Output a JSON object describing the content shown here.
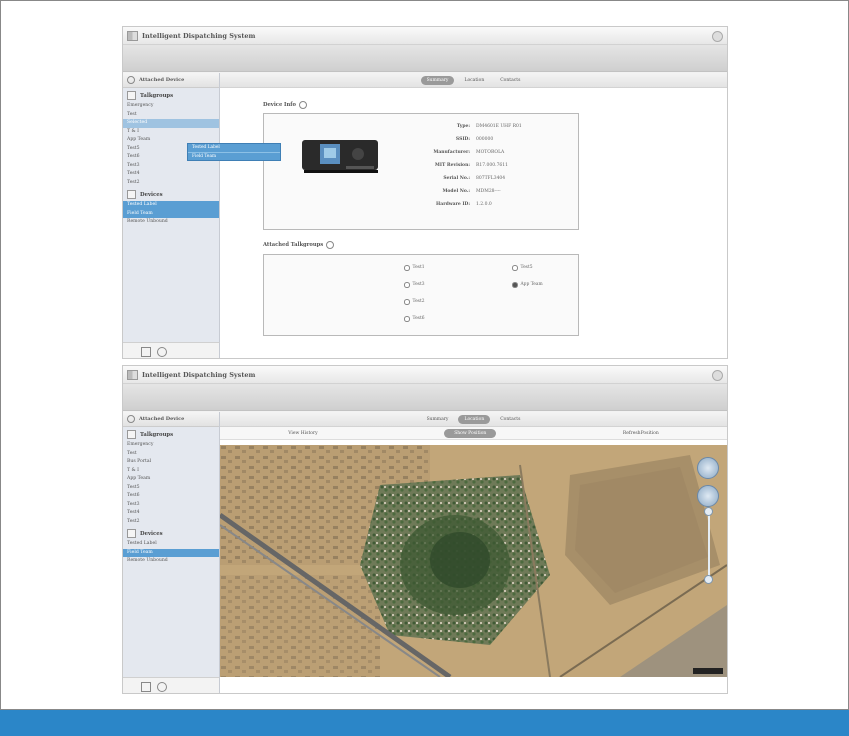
{
  "window_top": {
    "title": "Intelligent Dispatching System",
    "sidebar": {
      "header": "Attached Device",
      "talkgroups_title": "Talkgroups",
      "talkgroups": [
        "Emergency",
        "Test",
        "Selected",
        "T & I",
        "App Team",
        "Test5",
        "Test6",
        "Test3",
        "Test4",
        "Test2"
      ],
      "devices_title": "Devices",
      "devices": [
        "Tested Label",
        "Field Team",
        "Remote Unbound"
      ]
    },
    "tabs": [
      "Summary",
      "Location",
      "Contacts"
    ],
    "active_tab": 0,
    "popup_items": [
      "Tested Label",
      "Field Team"
    ],
    "device_info": {
      "title": "Device Info",
      "fields": [
        {
          "label": "Type:",
          "value": "DM4601E UHF R01"
        },
        {
          "label": "SSID:",
          "value": "000000"
        },
        {
          "label": "Manufacturer:",
          "value": "MOTOROLA"
        },
        {
          "label": "MIT Revision:",
          "value": "R17.000.7611"
        },
        {
          "label": "Serial No.:",
          "value": "807TFL3404"
        },
        {
          "label": "Model No.:",
          "value": "MDM28----"
        },
        {
          "label": "Hardware ID:",
          "value": "1.2.0.0"
        }
      ]
    },
    "attached_talkgroups": {
      "title": "Attached Talkgroups",
      "items": [
        {
          "label": "Test1",
          "checked": false
        },
        {
          "label": "Test3",
          "checked": false
        },
        {
          "label": "Test2",
          "checked": false
        },
        {
          "label": "App Team",
          "checked": true
        },
        {
          "label": "Test5",
          "checked": false
        },
        {
          "label": "Test6",
          "checked": false
        }
      ]
    }
  },
  "window_bottom": {
    "title": "Intelligent Dispatching System",
    "sidebar": {
      "header": "Attached Device",
      "talkgroups_title": "Talkgroups",
      "talkgroups": [
        "Emergency",
        "Test",
        "Bus Portal",
        "T & I",
        "App Team",
        "Test5",
        "Test6",
        "Test3",
        "Test4",
        "Test2"
      ],
      "devices_title": "Devices",
      "devices": [
        "Tested Label",
        "Field Team",
        "Remote Unbound"
      ]
    },
    "tabs": [
      "Summary",
      "Location",
      "Contacts"
    ],
    "active_tab": 1,
    "subtabs": [
      "View History",
      "Show Position",
      "RefreshPosition"
    ],
    "active_subtab": 1
  },
  "colors": {
    "accent": "#2b86c8",
    "selection": "#5a9ed3"
  }
}
